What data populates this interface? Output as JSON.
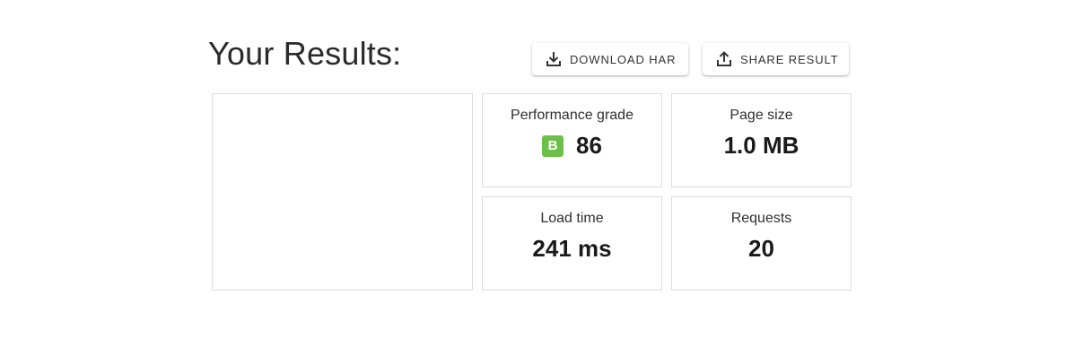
{
  "header": {
    "title": "Your Results:"
  },
  "actions": {
    "download_label": "DOWNLOAD HAR",
    "download_icon": "download-icon",
    "share_label": "SHARE RESULT",
    "share_icon": "share-upload-icon"
  },
  "metrics": {
    "performance": {
      "label": "Performance grade",
      "grade": "B",
      "score": "86",
      "grade_color": "#6cc04a"
    },
    "page_size": {
      "label": "Page size",
      "value": "1.0 MB"
    },
    "load_time": {
      "label": "Load time",
      "value": "241 ms"
    },
    "requests": {
      "label": "Requests",
      "value": "20"
    }
  }
}
